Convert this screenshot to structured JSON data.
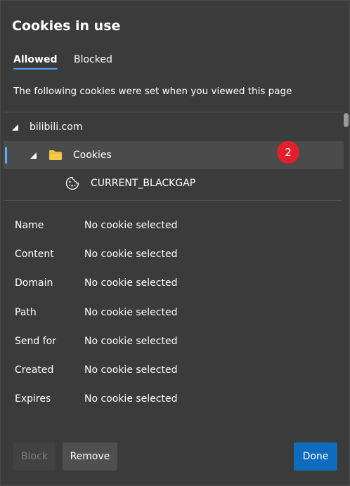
{
  "dialog": {
    "title": "Cookies in use",
    "tabs": [
      {
        "label": "Allowed",
        "selected": true
      },
      {
        "label": "Blocked",
        "selected": false
      }
    ],
    "description": "The following cookies were set when you viewed this page"
  },
  "tree": {
    "domain": {
      "label": "bilibili.com",
      "icon": "expanded-triangle-icon"
    },
    "folder": {
      "label": "Cookies",
      "icon": "folder-icon",
      "badge": "2",
      "badge_color": "#e0202e"
    },
    "cookie": {
      "label": "CURRENT_BLACKGAP",
      "icon": "cookie-icon"
    }
  },
  "details": [
    {
      "key": "Name",
      "value": "No cookie selected"
    },
    {
      "key": "Content",
      "value": "No cookie selected"
    },
    {
      "key": "Domain",
      "value": "No cookie selected"
    },
    {
      "key": "Path",
      "value": "No cookie selected"
    },
    {
      "key": "Send for",
      "value": "No cookie selected"
    },
    {
      "key": "Created",
      "value": "No cookie selected"
    },
    {
      "key": "Expires",
      "value": "No cookie selected"
    }
  ],
  "buttons": {
    "block": "Block",
    "remove": "Remove",
    "done": "Done"
  },
  "colors": {
    "accent": "#0f6cbd",
    "tab_underline": "#4aa0ff",
    "folder_yellow": "#f2c94c"
  }
}
